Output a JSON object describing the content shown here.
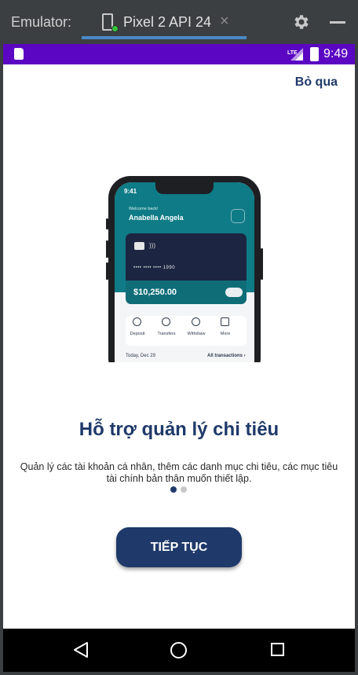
{
  "emulator": {
    "title": "Emulator:",
    "tab_label": "Pixel 2 API 24",
    "tab_close": "×",
    "accent": "#4a88c7"
  },
  "status_bar": {
    "time": "9:49",
    "network": "LTE",
    "color": "#5a06c2"
  },
  "onboarding": {
    "skip_label": "Bỏ qua",
    "title": "Hỗ trợ quản lý chi tiêu",
    "description": "Quản lý các tài khoản cá nhân, thêm các danh mục chi tiêu, các mục tiêu tài chính bản thân muốn thiết lập.",
    "page_index": 1,
    "page_count": 2,
    "cta_label": "TIẾP TỤC",
    "brand_color": "#1f3a6a"
  },
  "illustration": {
    "time": "9:41",
    "welcome": "Welcome back!",
    "user_name": "Anabella Angela",
    "card_number": "•••• •••• •••• 1990",
    "balance": "$10,250.00",
    "actions": [
      "Deposit",
      "Transfers",
      "Withdraw",
      "More"
    ],
    "date_label": "Today, Dec 29",
    "all_transactions": "All transactions ›"
  },
  "nav_bar": {
    "icons": [
      "back-icon",
      "home-icon",
      "recent-apps-icon"
    ]
  }
}
